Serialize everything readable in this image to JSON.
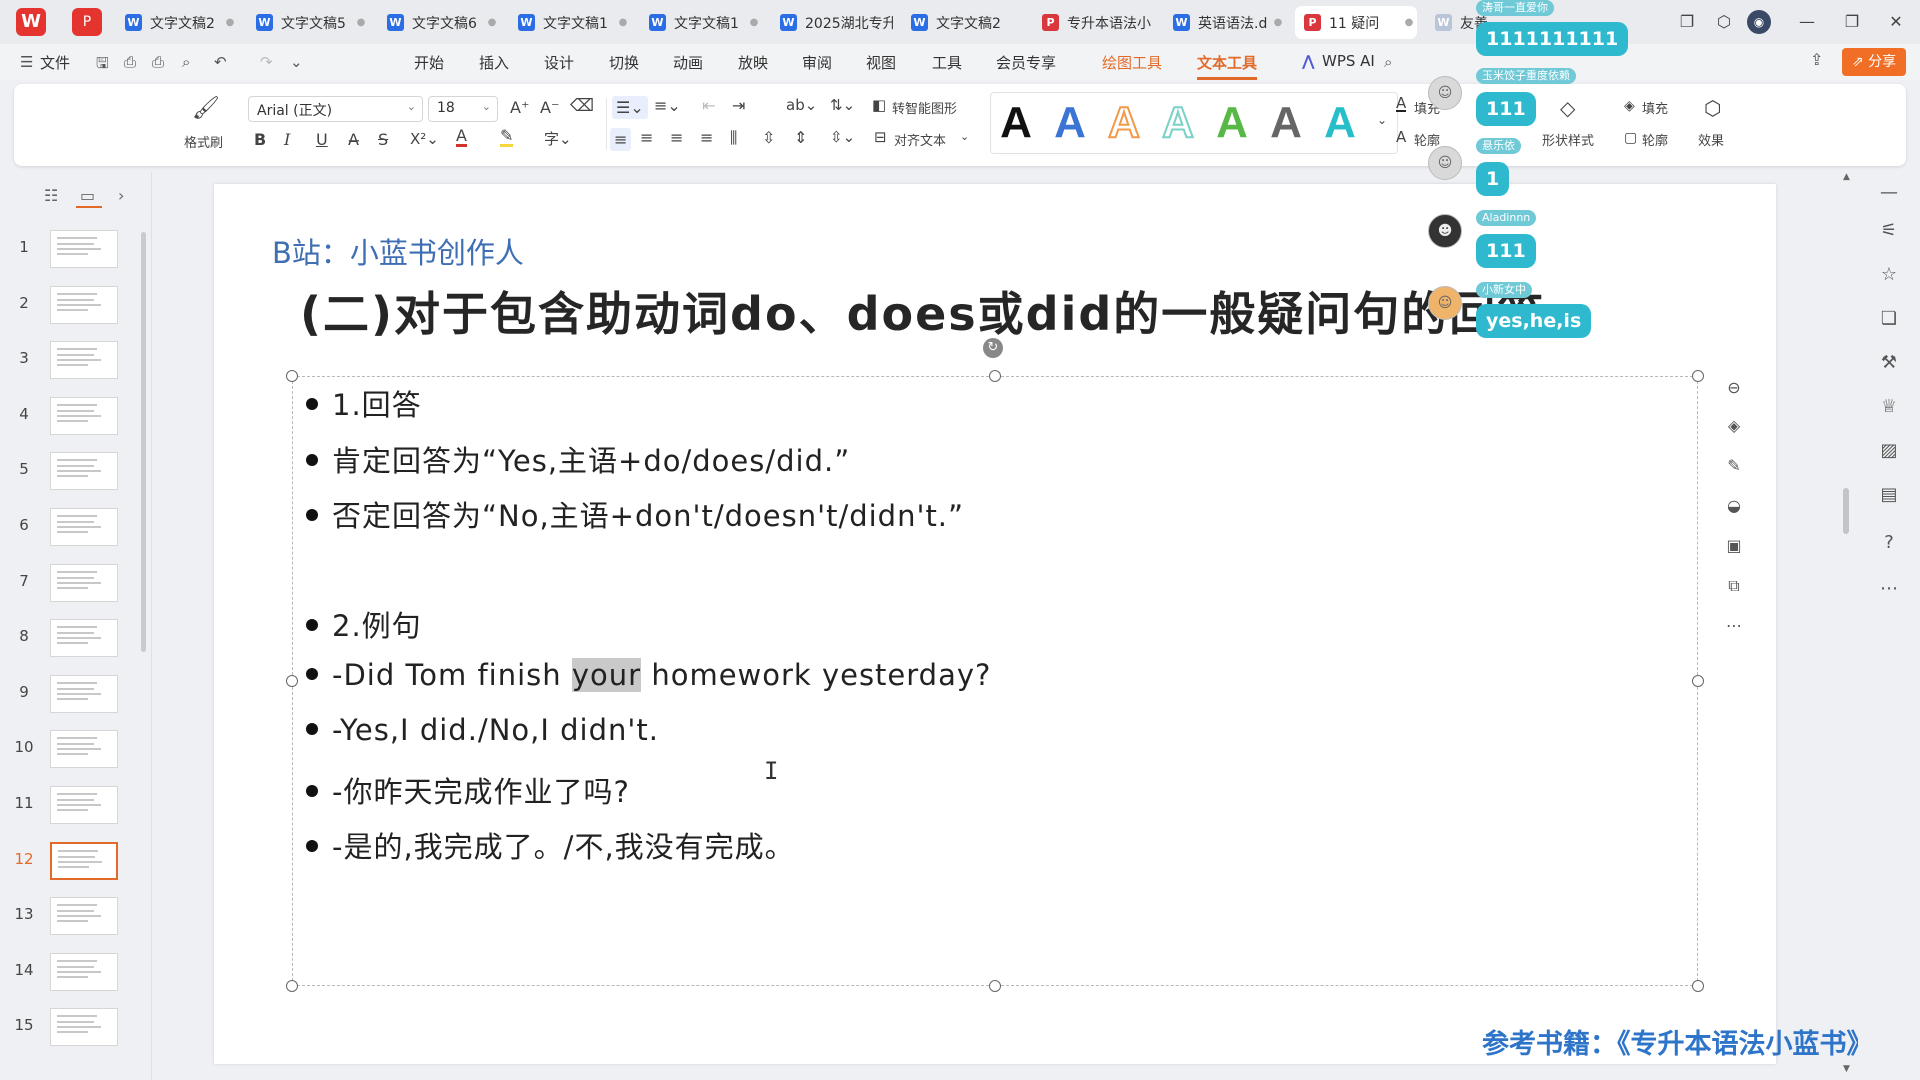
{
  "app": {
    "logo": "W",
    "pdf_logo": "P",
    "tabs": [
      {
        "label": "文字文稿2",
        "type": "W"
      },
      {
        "label": "文字文稿5",
        "type": "W"
      },
      {
        "label": "文字文稿6",
        "type": "W"
      },
      {
        "label": "文字文稿1",
        "type": "W"
      },
      {
        "label": "文字文稿1",
        "type": "W"
      },
      {
        "label": "2025湖北专升",
        "type": "W"
      },
      {
        "label": "文字文稿2",
        "type": "W"
      },
      {
        "label": "专升本语法小",
        "type": "P"
      },
      {
        "label": "英语语法.d",
        "type": "W"
      },
      {
        "label": "11 疑问",
        "type": "P"
      },
      {
        "label": "友善…",
        "type": "W"
      }
    ],
    "window_controls": {
      "minimize": "—",
      "restore": "❐",
      "close": "✕"
    }
  },
  "menubar": {
    "file_label": "文件",
    "items": [
      "开始",
      "插入",
      "设计",
      "切换",
      "动画",
      "放映",
      "审阅",
      "视图",
      "工具",
      "会员专享",
      "绘图工具",
      "文本工具"
    ],
    "wps_ai_label": "WPS AI",
    "share_label": "分享"
  },
  "ribbon": {
    "format_painter_label": "格式刷",
    "font_name": "Arial (正文)",
    "font_size": "18",
    "smart_shape_label": "转智能图形",
    "align_text_label": "对齐文本",
    "fill_label": "填充",
    "outline_label": "轮廓",
    "shape_style_label": "形状样式",
    "shape_fill_label": "填充",
    "shape_outline_label": "轮廓",
    "effect_label": "效果",
    "style_letter": "A",
    "style_colors": [
      "#111111",
      "#3b74d4",
      "#f19a4a",
      "#7ad1c7",
      "#57b846",
      "#666666",
      "#26bfc9"
    ]
  },
  "thumbnails": {
    "count": 15,
    "selected": 12,
    "numbers": [
      "1",
      "2",
      "3",
      "4",
      "5",
      "6",
      "7",
      "8",
      "9",
      "10",
      "11",
      "12",
      "13",
      "14",
      "15"
    ]
  },
  "slide": {
    "watermark": "B站：小蓝书创作人",
    "title": "(二)对于包含助动词do、does或did的一般疑问句的回答",
    "reference": "参考书籍：《专升本语法小蓝书》",
    "bullets": [
      {
        "text": "1.回答"
      },
      {
        "text": "肯定回答为“Yes,主语+do/does/did.”"
      },
      {
        "text": "否定回答为“No,主语+don't/doesn't/didn't.”"
      },
      {
        "text": ""
      },
      {
        "text": "2.例句"
      },
      {
        "pre": "-Did Tom finish ",
        "hl": "your",
        "post": " homework yesterday?"
      },
      {
        "text": "-Yes,I did./No,I didn't."
      },
      {
        "text": "-你昨天完成作业了吗?"
      },
      {
        "text": "-是的,我完成了。/不,我没有完成。"
      }
    ]
  },
  "danmaku": [
    {
      "name": "涛哥一直爱你",
      "message": "1111111111"
    },
    {
      "name": "玉米饺子重度依赖",
      "message": "111"
    },
    {
      "name": "悬乐依",
      "message": "1"
    },
    {
      "name": "Aladinnn",
      "message": "111"
    },
    {
      "name": "小新女中",
      "message": "yes,he,is"
    }
  ]
}
